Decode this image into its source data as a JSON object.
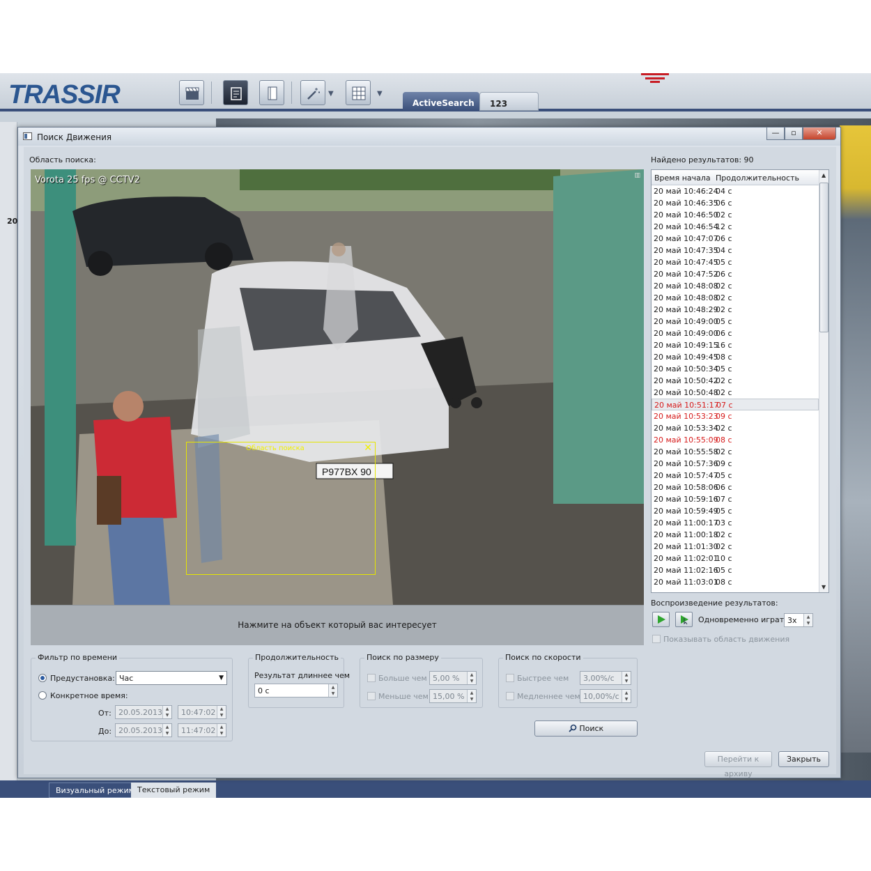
{
  "app": {
    "logo": "TRASSIR",
    "tabs": [
      {
        "label": "ActiveSearch"
      },
      {
        "label": "123"
      }
    ],
    "modes": {
      "visual": "Визуальный режим",
      "text": "Текстовый режим"
    },
    "side_number": "20"
  },
  "dialog": {
    "title": "Поиск Движения",
    "search_area_label": "Область поиска:",
    "video_title": "Vorota 25 fps @ CCTV2",
    "roi_label": "Область поиска",
    "plate": "P977BX 90",
    "hint": "Нажмите на объект который вас интересует",
    "results_found": "Найдено результатов: 90",
    "results": {
      "columns": [
        "Время начала",
        "Продолжительность"
      ],
      "rows": [
        {
          "start": "20 май 10:46:24",
          "dur": "04 с"
        },
        {
          "start": "20 май 10:46:35",
          "dur": "06 с"
        },
        {
          "start": "20 май 10:46:50",
          "dur": "02 с"
        },
        {
          "start": "20 май 10:46:54",
          "dur": "12 с"
        },
        {
          "start": "20 май 10:47:07",
          "dur": "06 с"
        },
        {
          "start": "20 май 10:47:35",
          "dur": "04 с"
        },
        {
          "start": "20 май 10:47:45",
          "dur": "05 с"
        },
        {
          "start": "20 май 10:47:52",
          "dur": "06 с"
        },
        {
          "start": "20 май 10:48:08",
          "dur": "02 с"
        },
        {
          "start": "20 май 10:48:08",
          "dur": "02 с"
        },
        {
          "start": "20 май 10:48:29",
          "dur": "02 с"
        },
        {
          "start": "20 май 10:49:00",
          "dur": "05 с"
        },
        {
          "start": "20 май 10:49:00",
          "dur": "06 с"
        },
        {
          "start": "20 май 10:49:15",
          "dur": "16 с"
        },
        {
          "start": "20 май 10:49:45",
          "dur": "08 с"
        },
        {
          "start": "20 май 10:50:34",
          "dur": "05 с"
        },
        {
          "start": "20 май 10:50:42",
          "dur": "02 с"
        },
        {
          "start": "20 май 10:50:48",
          "dur": "02 с"
        },
        {
          "start": "20 май 10:51:17",
          "dur": "07 с"
        },
        {
          "start": "20 май 10:53:23",
          "dur": "09 с"
        },
        {
          "start": "20 май 10:53:34",
          "dur": "02 с"
        },
        {
          "start": "20 май 10:55:09",
          "dur": "08 с"
        },
        {
          "start": "20 май 10:55:58",
          "dur": "02 с"
        },
        {
          "start": "20 май 10:57:36",
          "dur": "09 с"
        },
        {
          "start": "20 май 10:57:47",
          "dur": "05 с"
        },
        {
          "start": "20 май 10:58:06",
          "dur": "06 с"
        },
        {
          "start": "20 май 10:59:16",
          "dur": "07 с"
        },
        {
          "start": "20 май 10:59:49",
          "dur": "05 с"
        },
        {
          "start": "20 май 11:00:17",
          "dur": "03 с"
        },
        {
          "start": "20 май 11:00:18",
          "dur": "02 с"
        },
        {
          "start": "20 май 11:01:30",
          "dur": "02 с"
        },
        {
          "start": "20 май 11:02:01",
          "dur": "10 с"
        },
        {
          "start": "20 май 11:02:16",
          "dur": "05 с"
        },
        {
          "start": "20 май 11:03:01",
          "dur": "08 с"
        }
      ],
      "highlighted_starts": [
        "20 май 10:51:17",
        "20 май 10:53:23",
        "20 май 10:55:09"
      ],
      "selected_start": "20 май 10:51:17"
    },
    "playback": {
      "label": "Воспроизведение результатов:",
      "simultaneous_label": "Одновременно играть:",
      "simultaneous_value": "3x",
      "show_area_label": "Показывать область движения"
    },
    "time_filter": {
      "title": "Фильтр по времени",
      "preset_label": "Предустановка:",
      "preset_value": "Час",
      "specific_label": "Конкретное время:",
      "from_label": "От:",
      "to_label": "До:",
      "from_date": "20.05.2013",
      "from_time": "10:47:02",
      "to_date": "20.05.2013",
      "to_time": "11:47:02"
    },
    "duration": {
      "title": "Продолжительность",
      "label": "Результат длиннее чем",
      "value": "0 с"
    },
    "size": {
      "title": "Поиск по размеру",
      "larger_label": "Больше чем",
      "larger_value": "5,00 %",
      "smaller_label": "Меньше чем",
      "smaller_value": "15,00 %"
    },
    "speed": {
      "title": "Поиск по скорости",
      "faster_label": "Быстрее чем",
      "faster_value": "3,00%/с",
      "slower_label": "Медленнее чем",
      "slower_value": "10,00%/с"
    },
    "buttons": {
      "search": "Поиск",
      "goto_archive": "Перейти к архиву",
      "close": "Закрыть"
    }
  }
}
